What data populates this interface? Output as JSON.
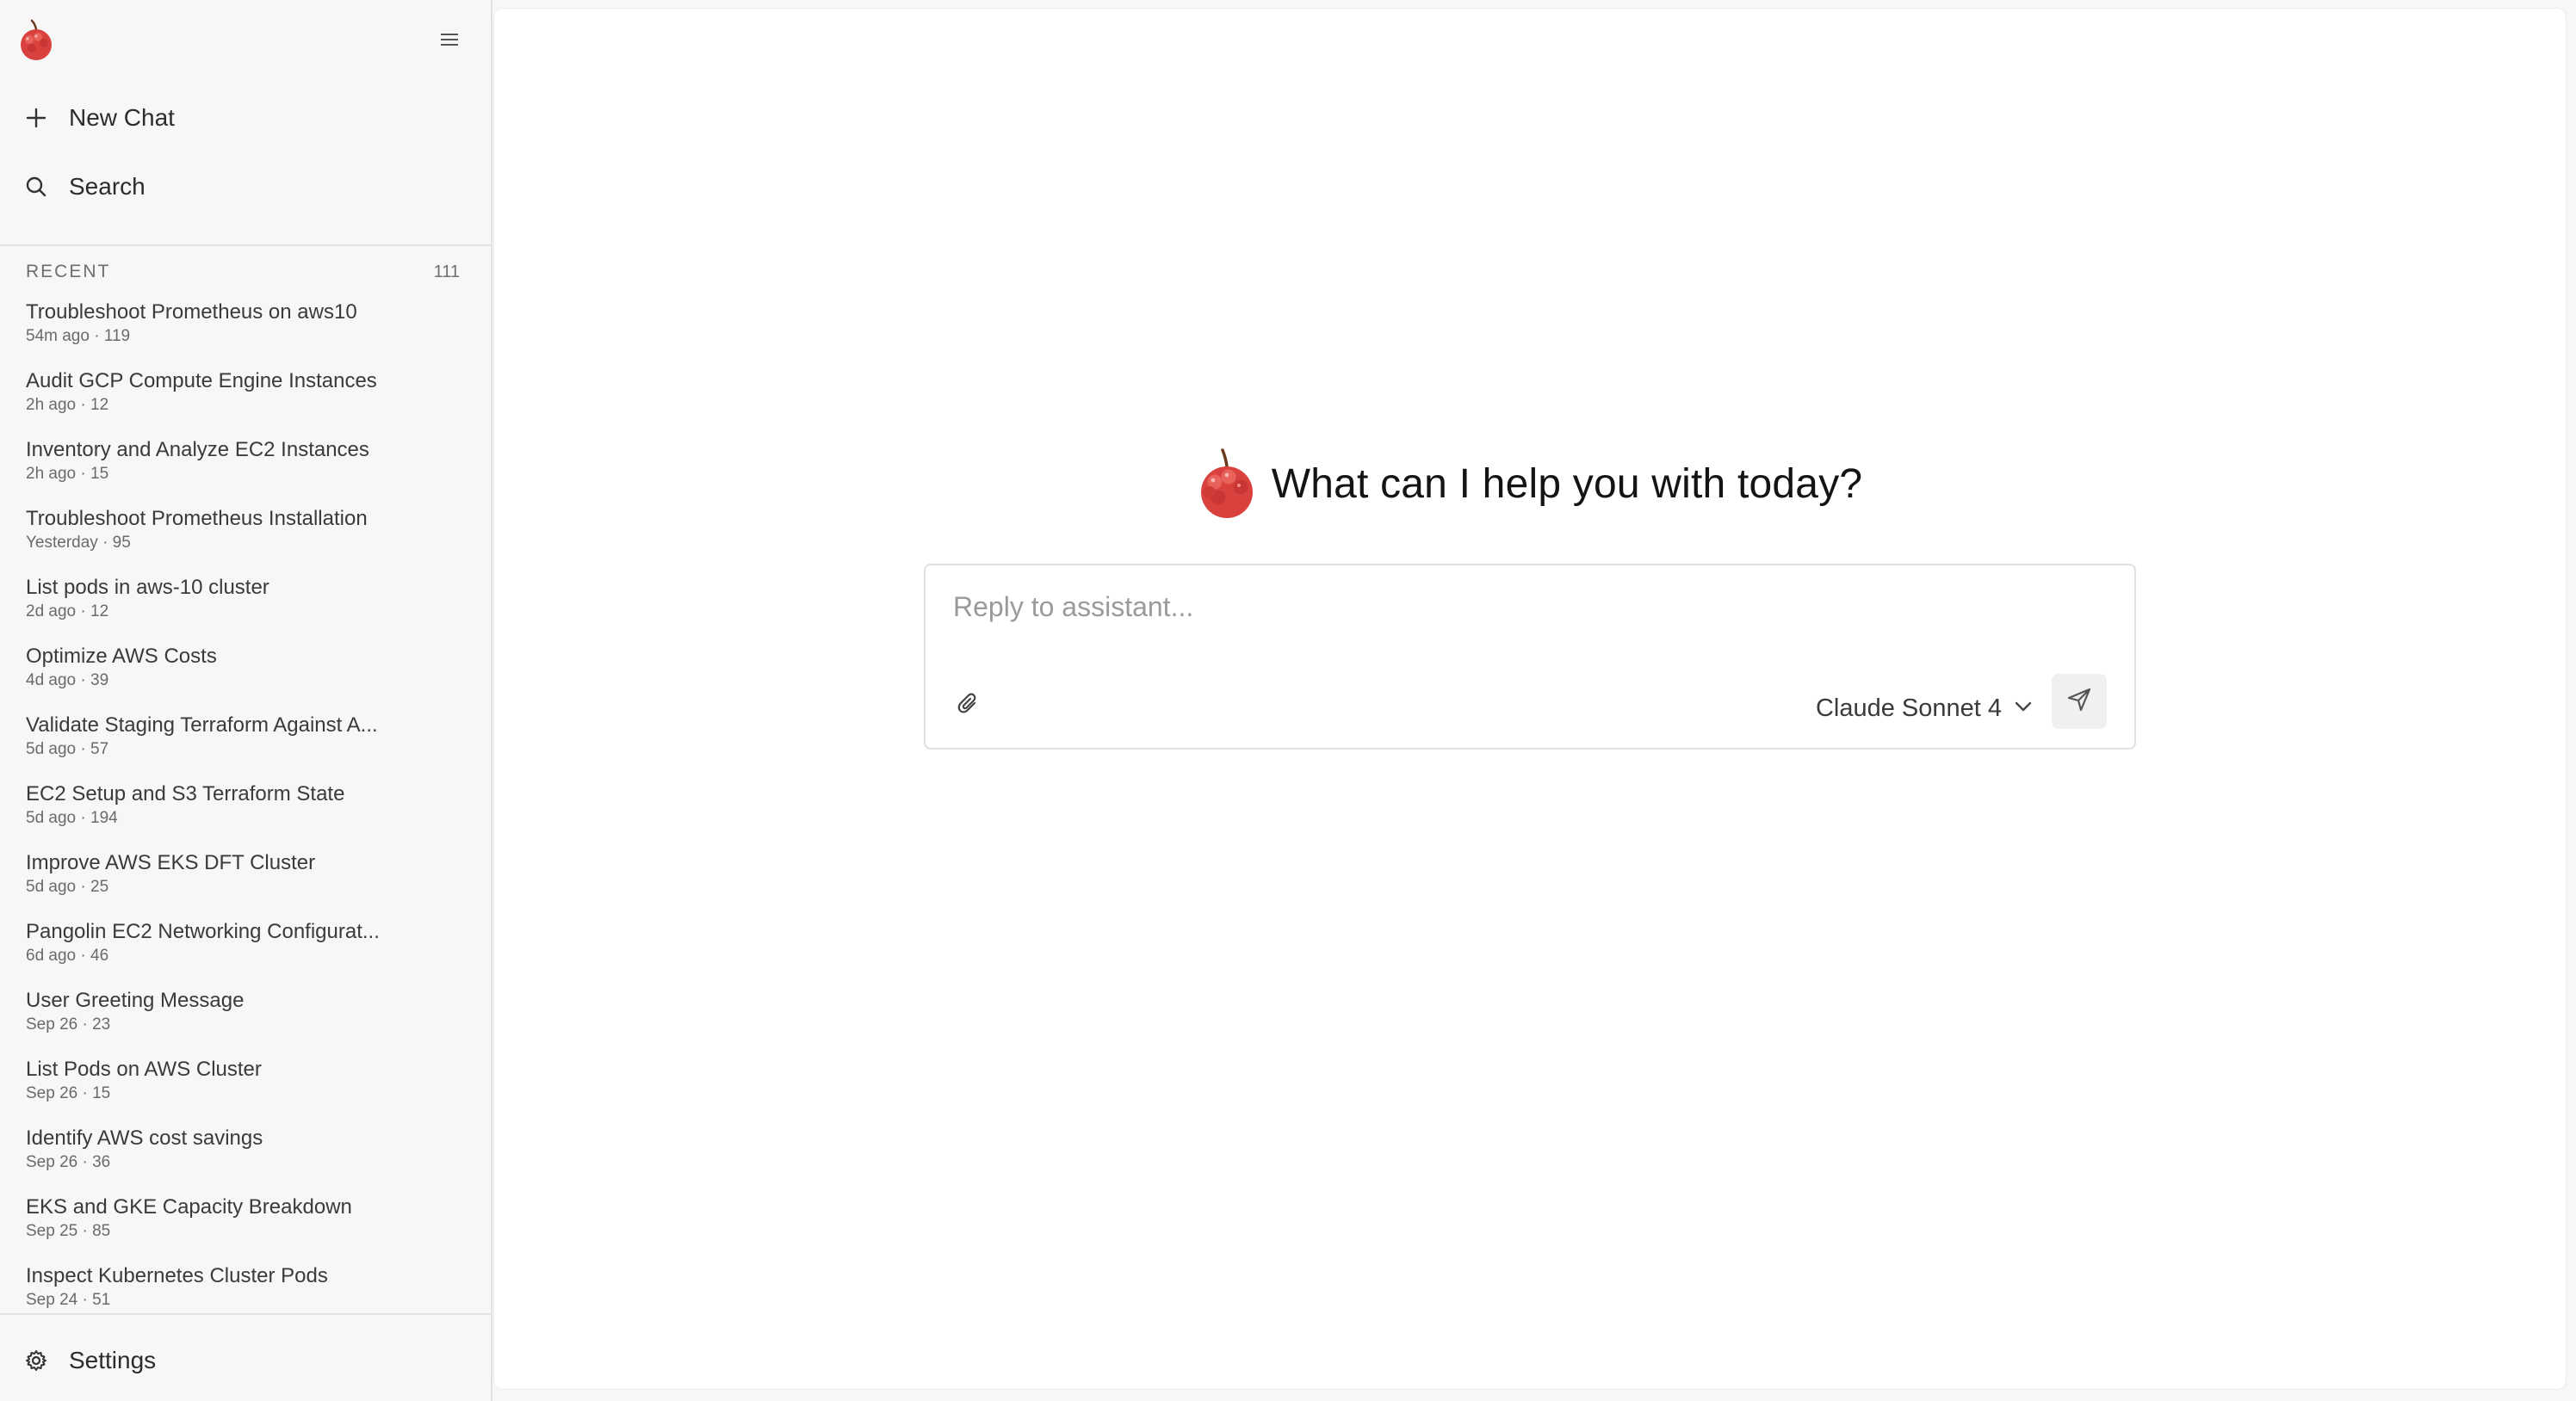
{
  "sidebar": {
    "logo_icon": "raspberry-logo",
    "menu_icon": "hamburger-menu-icon",
    "new_chat_label": "New Chat",
    "search_label": "Search",
    "recent_label": "RECENT",
    "recent_count": "111",
    "settings_label": "Settings",
    "chats": [
      {
        "title": "Troubleshoot Prometheus on aws10",
        "meta": "54m ago · 119"
      },
      {
        "title": "Audit GCP Compute Engine Instances",
        "meta": "2h ago · 12"
      },
      {
        "title": "Inventory and Analyze EC2 Instances",
        "meta": "2h ago · 15"
      },
      {
        "title": "Troubleshoot Prometheus Installation",
        "meta": "Yesterday · 95"
      },
      {
        "title": "List pods in aws-10 cluster",
        "meta": "2d ago · 12"
      },
      {
        "title": "Optimize AWS Costs",
        "meta": "4d ago · 39"
      },
      {
        "title": "Validate Staging Terraform Against A...",
        "meta": "5d ago · 57"
      },
      {
        "title": "EC2 Setup and S3 Terraform State",
        "meta": "5d ago · 194"
      },
      {
        "title": "Improve AWS EKS DFT Cluster",
        "meta": "5d ago · 25"
      },
      {
        "title": "Pangolin EC2 Networking Configurat...",
        "meta": "6d ago · 46"
      },
      {
        "title": "User Greeting Message",
        "meta": "Sep 26 · 23"
      },
      {
        "title": "List Pods on AWS Cluster",
        "meta": "Sep 26 · 15"
      },
      {
        "title": "Identify AWS cost savings",
        "meta": "Sep 26 · 36"
      },
      {
        "title": "EKS and GKE Capacity Breakdown",
        "meta": "Sep 25 · 85"
      },
      {
        "title": "Inspect Kubernetes Cluster Pods",
        "meta": "Sep 24 · 51"
      }
    ]
  },
  "main": {
    "welcome_text": "What can I help you with today?",
    "composer": {
      "placeholder": "Reply to assistant...",
      "value": "",
      "model_label": "Claude Sonnet 4"
    }
  },
  "colors": {
    "background": "#f7f7f7",
    "panel": "#ffffff",
    "border": "#e2e2e2",
    "send_button_bg": "#f0f0f0",
    "logo_red": "#d9413e"
  }
}
